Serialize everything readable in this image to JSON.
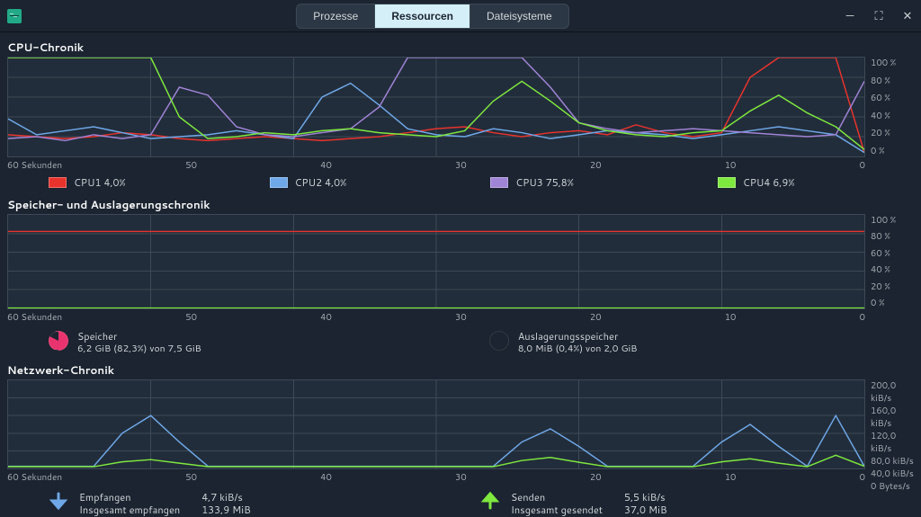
{
  "header": {
    "tabs": {
      "processes": "Prozesse",
      "resources": "Ressourcen",
      "filesystems": "Dateisysteme"
    }
  },
  "sections": {
    "cpu_title": "CPU-Chronik",
    "mem_title": "Speicher- und Auslagerungschronik",
    "net_title": "Netzwerk-Chronik"
  },
  "cpu_legend": {
    "cpu1": "CPU1 4,0%",
    "cpu2": "CPU2 4,0%",
    "cpu3": "CPU3 75,8%",
    "cpu4": "CPU4 6,9%"
  },
  "mem_legend": {
    "mem_label": "Speicher",
    "mem_value": "6,2 GiB (82,3%) von 7,5 GiB",
    "swap_label": "Auslagerungsspeicher",
    "swap_value": "8,0 MiB (0,4%) von 2,0 GiB"
  },
  "net_legend": {
    "recv_label": "Empfangen",
    "recv_rate": "4,7 kiB/s",
    "recv_total_label": "Insgesamt empfangen",
    "recv_total": "133,9 MiB",
    "send_label": "Senden",
    "send_rate": "5,5 kiB/s",
    "send_total_label": "Insgesamt gesendet",
    "send_total": "37,0 MiB"
  },
  "axes": {
    "time_label": "60 Sekunden",
    "ticks": [
      "50",
      "40",
      "30",
      "20",
      "10",
      "0"
    ],
    "pct": [
      "100 %",
      "80 %",
      "60 %",
      "40 %",
      "20 %",
      "0 %"
    ],
    "net_y": [
      "200,0 kiB/s",
      "160,0 kiB/s",
      "120,0 kiB/s",
      "80,0 kiB/s",
      "40,0 kiB/s",
      "0 Bytes/s"
    ]
  },
  "chart_data": [
    {
      "type": "line",
      "title": "CPU-Chronik",
      "xlabel": "Sekunden",
      "ylabel": "%",
      "ylim": [
        0,
        100
      ],
      "xlim": [
        0,
        60
      ],
      "x": [
        0,
        2,
        4,
        6,
        8,
        10,
        12,
        14,
        16,
        18,
        20,
        22,
        24,
        26,
        28,
        30,
        32,
        34,
        36,
        38,
        40,
        42,
        44,
        46,
        48,
        50,
        52,
        54,
        56,
        58,
        60
      ],
      "series": [
        {
          "name": "CPU1",
          "color": "#e8332c",
          "values": [
            22,
            20,
            18,
            20,
            24,
            22,
            18,
            16,
            18,
            20,
            18,
            16,
            18,
            20,
            24,
            28,
            30,
            24,
            20,
            24,
            26,
            22,
            32,
            24,
            20,
            24,
            80,
            100,
            100,
            100,
            4
          ]
        },
        {
          "name": "CPU2",
          "color": "#6ea8e8",
          "values": [
            38,
            22,
            26,
            30,
            24,
            18,
            20,
            22,
            26,
            22,
            18,
            60,
            74,
            52,
            28,
            22,
            20,
            28,
            24,
            18,
            22,
            26,
            24,
            22,
            18,
            22,
            26,
            30,
            26,
            22,
            4
          ]
        },
        {
          "name": "CPU3",
          "color": "#a084d6",
          "values": [
            18,
            20,
            16,
            22,
            18,
            22,
            70,
            62,
            30,
            22,
            20,
            24,
            28,
            50,
            100,
            100,
            100,
            100,
            100,
            70,
            34,
            28,
            24,
            26,
            28,
            26,
            24,
            22,
            20,
            22,
            76
          ]
        },
        {
          "name": "CPU4",
          "color": "#7ee83e",
          "values": [
            100,
            100,
            100,
            100,
            100,
            100,
            40,
            18,
            20,
            24,
            22,
            26,
            28,
            24,
            22,
            20,
            26,
            56,
            76,
            56,
            34,
            26,
            22,
            20,
            24,
            26,
            46,
            62,
            44,
            30,
            7
          ]
        }
      ]
    },
    {
      "type": "line",
      "title": "Speicher- und Auslagerungschronik",
      "xlabel": "Sekunden",
      "ylabel": "%",
      "ylim": [
        0,
        100
      ],
      "xlim": [
        0,
        60
      ],
      "x": [
        0,
        60
      ],
      "series": [
        {
          "name": "Speicher",
          "color": "#e8332c",
          "values": [
            82.3,
            82.3
          ]
        },
        {
          "name": "Auslagerungsspeicher",
          "color": "#7ee83e",
          "values": [
            0.4,
            0.4
          ]
        }
      ]
    },
    {
      "type": "line",
      "title": "Netzwerk-Chronik",
      "xlabel": "Sekunden",
      "ylabel": "kiB/s",
      "ylim": [
        0,
        200
      ],
      "xlim": [
        0,
        60
      ],
      "x": [
        0,
        2,
        4,
        6,
        8,
        10,
        12,
        14,
        16,
        18,
        20,
        22,
        24,
        26,
        28,
        30,
        32,
        34,
        36,
        38,
        40,
        42,
        44,
        46,
        48,
        50,
        52,
        54,
        56,
        58,
        60
      ],
      "series": [
        {
          "name": "Empfangen",
          "color": "#6ea8e8",
          "values": [
            5,
            5,
            5,
            5,
            80,
            120,
            60,
            5,
            5,
            5,
            5,
            5,
            5,
            5,
            5,
            5,
            5,
            5,
            60,
            90,
            50,
            5,
            5,
            5,
            5,
            60,
            100,
            50,
            5,
            120,
            5
          ]
        },
        {
          "name": "Senden",
          "color": "#7ee83e",
          "values": [
            4,
            4,
            4,
            4,
            15,
            20,
            12,
            4,
            4,
            4,
            4,
            4,
            4,
            4,
            4,
            4,
            4,
            4,
            18,
            25,
            14,
            4,
            4,
            4,
            4,
            15,
            22,
            12,
            4,
            30,
            5
          ]
        }
      ]
    }
  ]
}
